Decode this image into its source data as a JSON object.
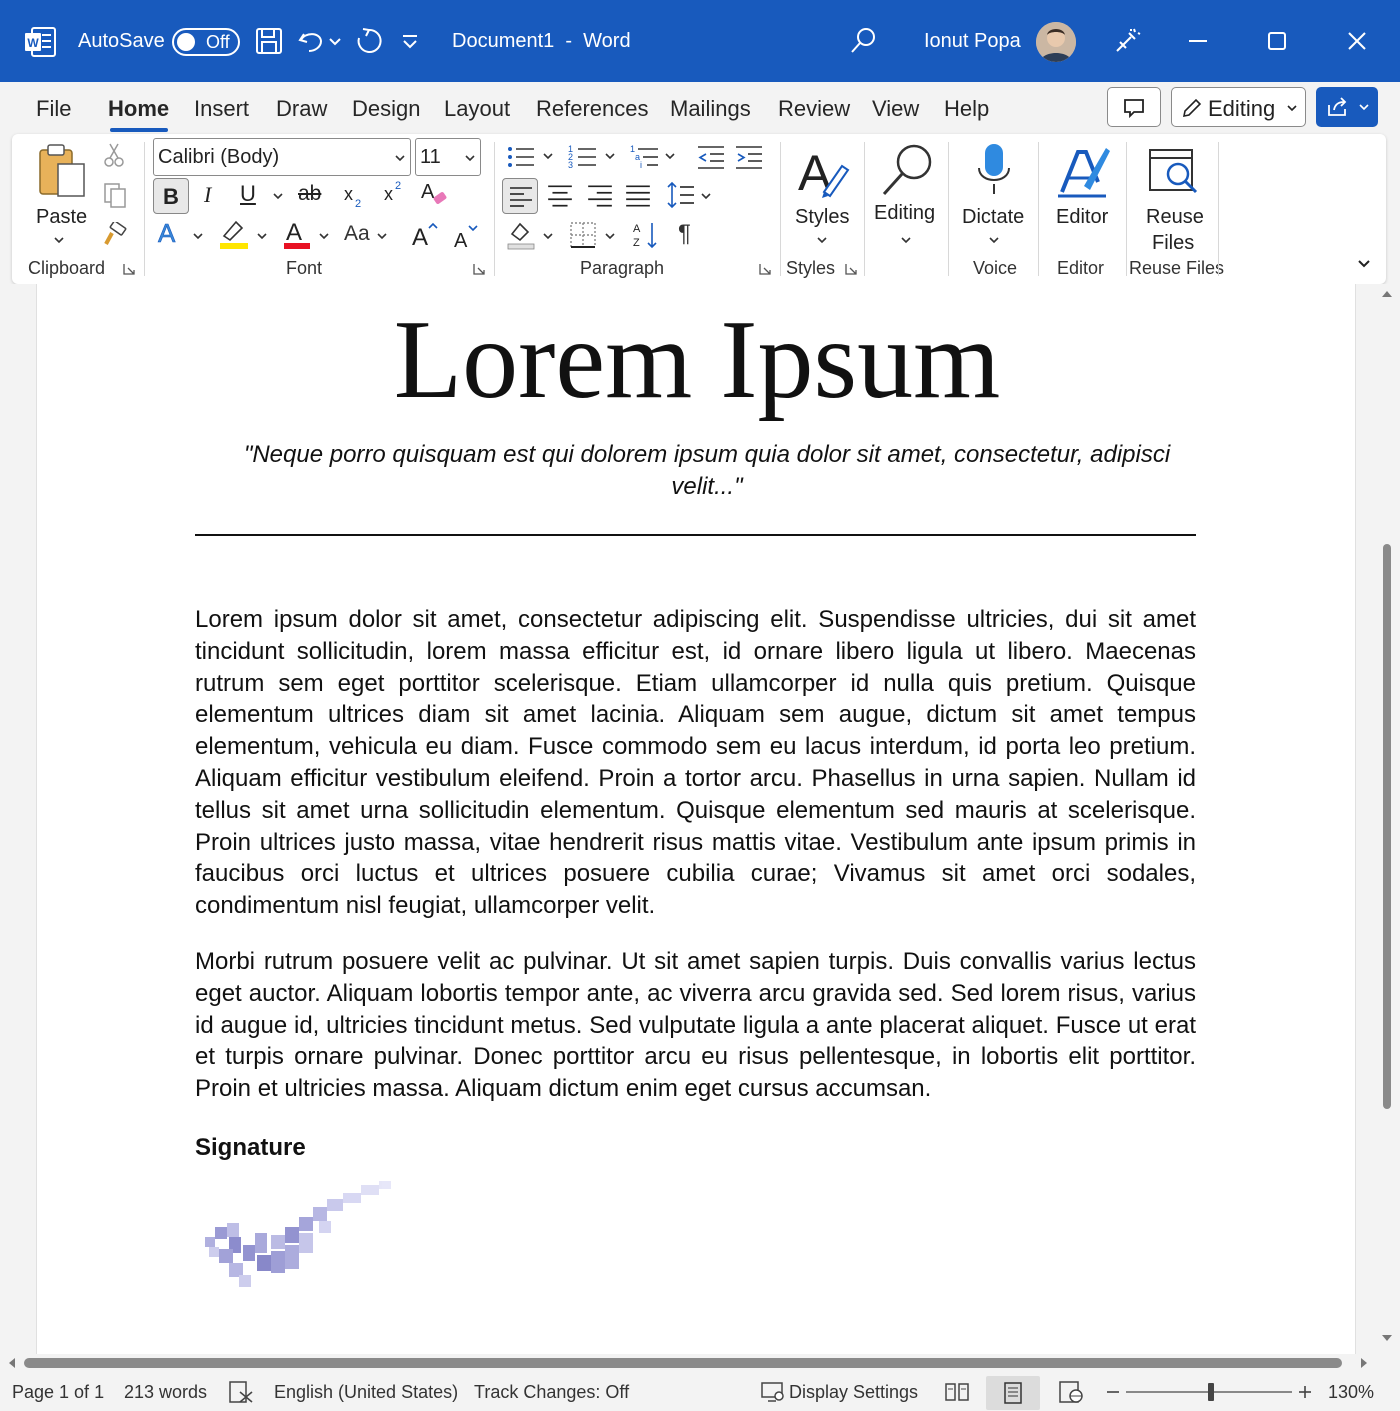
{
  "titlebar": {
    "autosave_label": "AutoSave",
    "autosave_state": "Off",
    "document_title": "Document1  -  Word",
    "user_name": "Ionut Popa",
    "accent_color": "#185abd",
    "icons": [
      "word-logo-icon",
      "save-icon",
      "undo-icon",
      "redo-icon",
      "customize-qat-icon",
      "search-icon",
      "designer-icon",
      "minimize-icon",
      "maximize-icon",
      "close-icon"
    ]
  },
  "tabs": {
    "file": "File",
    "home": "Home",
    "insert": "Insert",
    "draw": "Draw",
    "design": "Design",
    "layout": "Layout",
    "references": "References",
    "mailings": "Mailings",
    "review": "Review",
    "view": "View",
    "help": "Help",
    "active": "Home",
    "editing_mode": "Editing"
  },
  "ribbon": {
    "clipboard": {
      "paste": "Paste",
      "group": "Clipboard"
    },
    "font": {
      "family": "Calibri (Body)",
      "size": "11",
      "bold": "B",
      "italic": "I",
      "underline": "U",
      "strike": "ab",
      "change_case": "Aa",
      "group": "Font"
    },
    "paragraph": {
      "group": "Paragraph"
    },
    "styles": {
      "label": "Styles",
      "group": "Styles"
    },
    "editing": {
      "label": "Editing"
    },
    "voice": {
      "label": "Dictate",
      "group": "Voice"
    },
    "editor": {
      "label": "Editor",
      "group": "Editor"
    },
    "reuse": {
      "label_line1": "Reuse",
      "label_line2": "Files",
      "group": "Reuse Files"
    }
  },
  "document": {
    "title": "Lorem Ipsum",
    "quote": "\"Neque porro quisquam est qui dolorem ipsum quia dolor sit amet, consectetur, adipisci velit...\"",
    "paragraphs": [
      "Lorem ipsum dolor sit amet, consectetur adipiscing elit. Suspendisse ultricies, dui sit amet tincidunt sollicitudin, lorem massa efficitur est, id ornare libero ligula ut libero. Maecenas rutrum sem eget porttitor scelerisque. Etiam ullamcorper id nulla quis pretium. Quisque elementum ultrices diam sit amet lacinia. Aliquam sem augue, dictum sit amet tempus elementum, vehicula eu diam. Fusce commodo sem eu lacus interdum, id porta leo pretium. Aliquam efficitur vestibulum eleifend. Proin a tortor arcu. Phasellus in urna sapien. Nullam id tellus sit amet urna sollicitudin elementum. Quisque elementum sed mauris at scelerisque. Proin ultrices justo massa, vitae hendrerit risus mattis vitae. Vestibulum ante ipsum primis in faucibus orci luctus et ultrices posuere cubilia curae; Vivamus sit amet orci sodales, condimentum nisl feugiat, ullamcorper velit.",
      "Morbi rutrum posuere velit ac pulvinar. Ut sit amet sapien turpis. Duis convallis varius lectus eget auctor. Aliquam lobortis tempor ante, ac viverra arcu gravida sed. Sed lorem risus, varius id augue id, ultricies tincidunt metus. Sed vulputate ligula a ante placerat aliquet. Fusce ut erat et turpis ornare pulvinar. Donec porttitor arcu eu risus pellentesque, in lobortis elit porttitor. Proin et ultricies massa. Aliquam dictum enim eget cursus accumsan."
    ],
    "signature_heading": "Signature"
  },
  "statusbar": {
    "page": "Page 1 of 1",
    "words": "213 words",
    "language": "English (United States)",
    "track_changes": "Track Changes: Off",
    "display_settings": "Display Settings",
    "zoom": "130%"
  }
}
